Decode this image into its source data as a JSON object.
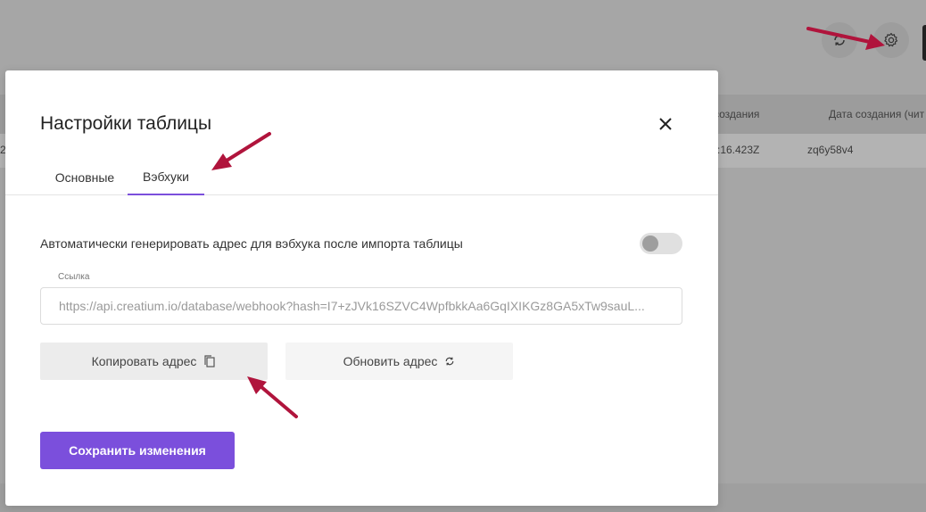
{
  "background": {
    "table_header": {
      "col_a": "создания",
      "col_b": "Дата создания (чит"
    },
    "table_row": {
      "left_fragment": "2",
      "cell_a": "):16.423Z",
      "cell_b": "zq6y58v4"
    },
    "header_icons": [
      "refresh-icon",
      "gear-icon"
    ]
  },
  "modal": {
    "title": "Настройки таблицы",
    "tabs": [
      {
        "label": "Основные",
        "active": false
      },
      {
        "label": "Вэбхуки",
        "active": true
      }
    ],
    "auto_generate_label": "Автоматически генерировать адрес для вэбхука после импорта таблицы",
    "auto_generate_enabled": false,
    "link_label": "Ссылка",
    "link_value": "https://api.creatium.io/database/webhook?hash=I7+zJVk16SZVC4WpfbkkAa6GqIXIKGz8GA5xTw9sauL...",
    "copy_button_label": "Копировать адрес",
    "refresh_button_label": "Обновить адрес",
    "save_button_label": "Сохранить изменения"
  },
  "colors": {
    "accent": "#7b4fdc",
    "annotation_arrow": "#b0143c",
    "overlay": "#a6a6a6"
  }
}
